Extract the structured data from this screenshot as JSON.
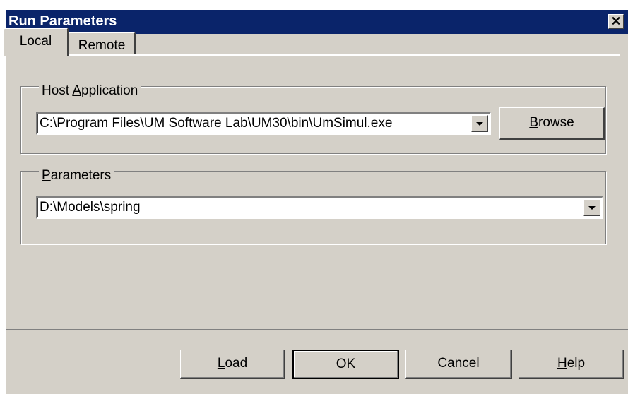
{
  "window": {
    "title": "Run Parameters",
    "close_glyph": "✕"
  },
  "tabs": [
    {
      "label": "Local",
      "selected": true
    },
    {
      "label": "Remote",
      "selected": false
    }
  ],
  "host_application": {
    "legend_pre": "Host ",
    "legend_accel": "A",
    "legend_post": "pplication",
    "value": "C:\\Program Files\\UM Software Lab\\UM30\\bin\\UmSimul.exe",
    "browse_pre": "",
    "browse_accel": "B",
    "browse_post": "rowse"
  },
  "parameters": {
    "legend_pre": "",
    "legend_accel": "P",
    "legend_post": "arameters",
    "value": "D:\\Models\\spring"
  },
  "buttons": {
    "load_accel": "L",
    "load_post": "oad",
    "ok": "OK",
    "cancel": "Cancel",
    "help_accel": "H",
    "help_post": "elp"
  }
}
